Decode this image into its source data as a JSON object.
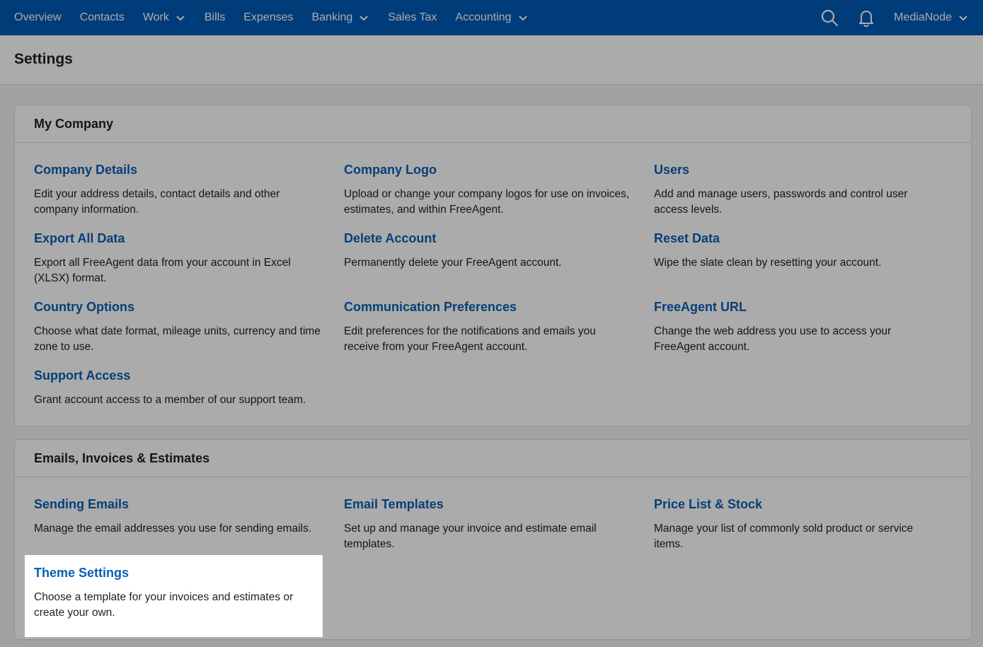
{
  "nav": {
    "items": [
      {
        "label": "Overview",
        "dropdown": false
      },
      {
        "label": "Contacts",
        "dropdown": false
      },
      {
        "label": "Work",
        "dropdown": true
      },
      {
        "label": "Bills",
        "dropdown": false
      },
      {
        "label": "Expenses",
        "dropdown": false
      },
      {
        "label": "Banking",
        "dropdown": true
      },
      {
        "label": "Sales Tax",
        "dropdown": false
      },
      {
        "label": "Accounting",
        "dropdown": true
      }
    ],
    "user": "MediaNode"
  },
  "page": {
    "title": "Settings"
  },
  "my_company": {
    "title": "My Company",
    "items": [
      {
        "label": "Company Details",
        "desc": "Edit your address details, contact details and other company information."
      },
      {
        "label": "Company Logo",
        "desc": "Upload or change your company logos for use on invoices, estimates, and within FreeAgent."
      },
      {
        "label": "Users",
        "desc": "Add and manage users, passwords and control user access levels."
      },
      {
        "label": "Export All Data",
        "desc": "Export all FreeAgent data from your account in Excel (XLSX) format."
      },
      {
        "label": "Delete Account",
        "desc": "Permanently delete your FreeAgent account."
      },
      {
        "label": "Reset Data",
        "desc": "Wipe the slate clean by resetting your account."
      },
      {
        "label": "Country Options",
        "desc": "Choose what date format, mileage units, currency and time zone to use."
      },
      {
        "label": "Communication Preferences",
        "desc": "Edit preferences for the notifications and emails you receive from your FreeAgent account."
      },
      {
        "label": "FreeAgent URL",
        "desc": "Change the web address you use to access your FreeAgent account."
      },
      {
        "label": "Support Access",
        "desc": "Grant account access to a member of our support team."
      }
    ]
  },
  "emails": {
    "title": "Emails, Invoices & Estimates",
    "items": [
      {
        "label": "Sending Emails",
        "desc": "Manage the email addresses you use for sending emails."
      },
      {
        "label": "Email Templates",
        "desc": "Set up and manage your invoice and estimate email templates."
      },
      {
        "label": "Price List & Stock",
        "desc": "Manage your list of commonly sold product or service items."
      },
      {
        "label": "Theme Settings",
        "desc": "Choose a template for your invoices and estimates or create your own."
      }
    ]
  },
  "colors": {
    "nav_bg": "#005ab7",
    "link": "#0a5fb3",
    "overlay": "rgba(0,0,0,0.33)"
  },
  "icons": {
    "search": "search-icon",
    "notifications": "bell-icon",
    "dropdown": "chevron-down-icon"
  }
}
